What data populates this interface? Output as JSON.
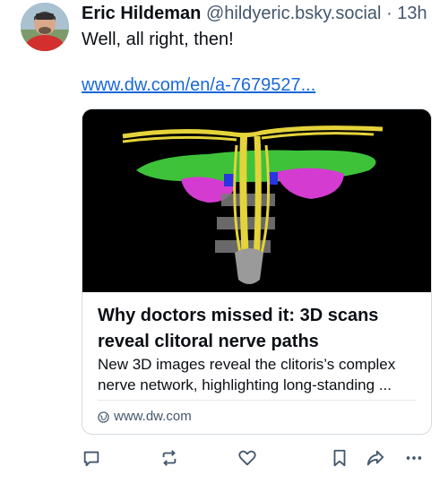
{
  "post": {
    "author_name": "Eric Hildeman",
    "author_handle": "@hildyeric.bsky.social",
    "separator": "·",
    "time": "13h",
    "text": "Well, all right, then!",
    "link_text": "www.dw.com/en/a-7679527..."
  },
  "card": {
    "title": "Why doctors missed it: 3D scans reveal clitoral nerve paths",
    "description": "New 3D images reveal the clitoris’s complex nerve network, highlighting long-standing ...",
    "domain": "www.dw.com"
  },
  "actions": {
    "reply_icon": "reply-icon",
    "repost_icon": "repost-icon",
    "like_icon": "heart-icon",
    "bookmark_icon": "bookmark-icon",
    "share_icon": "share-icon",
    "more_icon": "more-icon"
  },
  "colors": {
    "link": "#1a68d8",
    "muted": "#42576c",
    "border": "#d4dbe2",
    "image_bg": "#000000"
  }
}
